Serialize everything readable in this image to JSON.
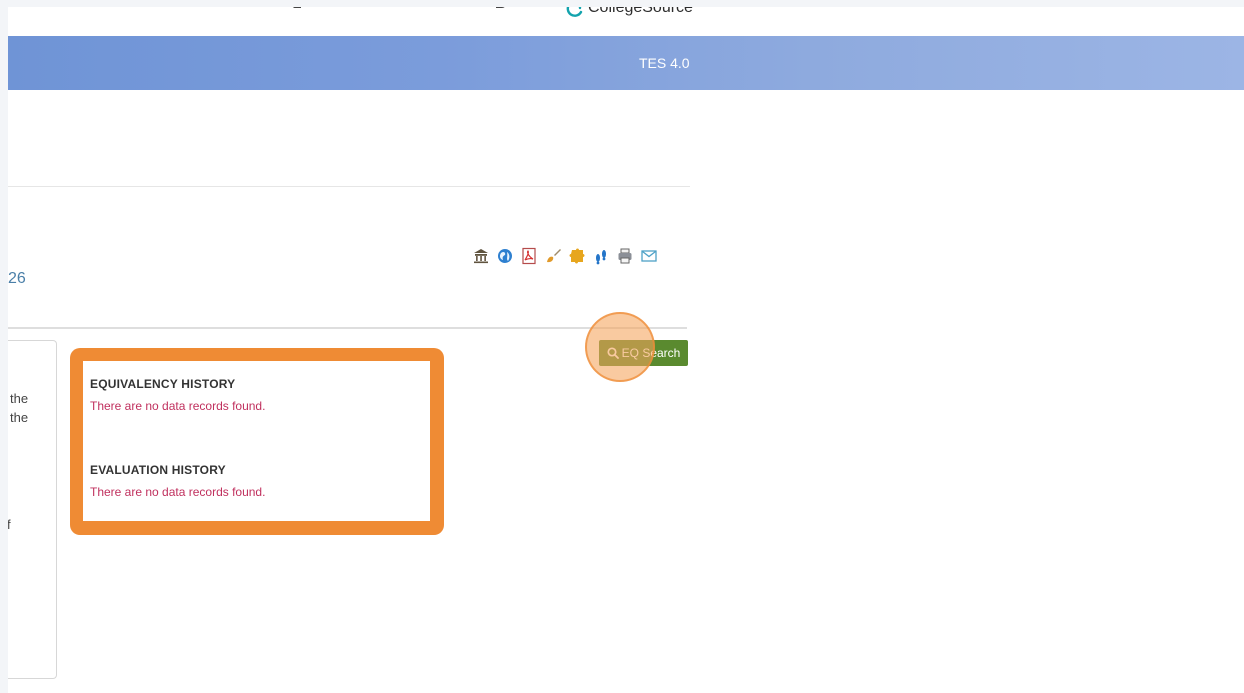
{
  "brand": {
    "name": "CollegeSource",
    "mark_icon": "collegesource-logo-icon"
  },
  "header": {
    "version": "TES 4.0",
    "gradient_start": "#6f94d6",
    "gradient_end": "#9cb5e5"
  },
  "toolbar": {
    "icons": [
      "institution-icon",
      "globe-icon",
      "pdf-icon",
      "brush-icon",
      "puzzle-icon",
      "footprints-icon",
      "print-icon",
      "email-icon"
    ]
  },
  "main": {
    "number_fragment": "26",
    "left_fragments": {
      "line1": "the",
      "line2": "the",
      "line3": "f"
    },
    "search_button": {
      "label": "EQ Search",
      "icon": "search-icon",
      "color": "#5a8a2f"
    },
    "history": {
      "equivalency_title": "EQUIVALENCY HISTORY",
      "equivalency_message": "There are no data records found.",
      "evaluation_title": "EVALUATION HISTORY",
      "evaluation_message": "There are no data records found.",
      "highlight_color": "#ef8b34",
      "message_color": "#c0305e"
    }
  }
}
